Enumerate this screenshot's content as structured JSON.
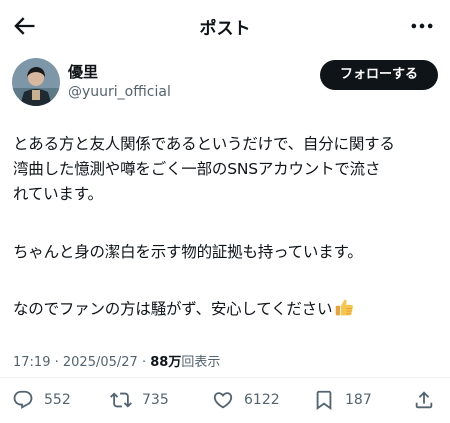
{
  "header": {
    "title": "ポスト",
    "back_icon": "arrow-left-icon",
    "more_icon": "ellipsis-icon"
  },
  "author": {
    "name": "優里",
    "handle": "@yuuri_official",
    "follow_label": "フォローする"
  },
  "post": {
    "lines": [
      "とある方と友人関係であるというだけで、自分に関する",
      "湾曲した憶測や噂をごく一部のSNSアカウントで流さ",
      "れています。",
      "ちゃんと身の潔白を示す物的証拠も持っています。",
      "なのでファンの方は騒がず、安心してください"
    ],
    "emoji": "thumbs-up-emoji"
  },
  "meta": {
    "time": "17:19",
    "separator": "·",
    "date": "2025/05/27",
    "views_count": "88万",
    "views_label": "回表示"
  },
  "actions": {
    "replies": "552",
    "reposts": "735",
    "likes": "6122",
    "bookmarks": "187"
  }
}
